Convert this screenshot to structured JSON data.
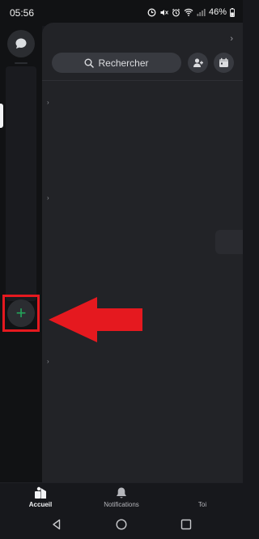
{
  "status_bar": {
    "time": "05:56",
    "battery": "46%",
    "icons": [
      "sync-icon",
      "mute-icon",
      "alarm-icon",
      "wifi-icon",
      "signal-icon",
      "battery-icon"
    ]
  },
  "rail": {
    "dm_icon": "chat-bubble-icon",
    "add_server_icon": "plus-icon",
    "add_server_symbol": "+",
    "highlight_color": "#e5191f",
    "plus_color": "#23a55a"
  },
  "main": {
    "search_placeholder": "Rechercher",
    "search_icon": "search-icon",
    "actions": [
      "add-friend-icon",
      "calendar-icon"
    ]
  },
  "annotation": {
    "type": "arrow",
    "direction": "left",
    "color": "#e5191f"
  },
  "bottom_nav": {
    "items": [
      {
        "label": "Accueil",
        "icon": "home-icon",
        "active": true
      },
      {
        "label": "Notifications",
        "icon": "bell-icon",
        "active": false
      },
      {
        "label": "Toi",
        "icon": "avatar-icon",
        "active": false
      }
    ]
  },
  "system_nav": [
    "back-icon",
    "home-circle-icon",
    "recents-icon"
  ]
}
